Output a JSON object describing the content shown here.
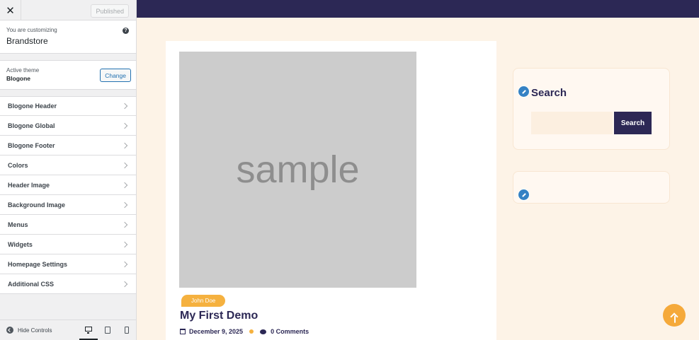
{
  "sidebar": {
    "close_icon": "close-icon",
    "publish_label": "Published",
    "customizing_label": "You are customizing",
    "site_name": "Brandstore",
    "active_theme_label": "Active theme",
    "theme_name": "Blogone",
    "change_label": "Change",
    "sections": [
      {
        "label": "Blogone Header"
      },
      {
        "label": "Blogone Global"
      },
      {
        "label": "Blogone Footer"
      },
      {
        "label": "Colors"
      },
      {
        "label": "Header Image"
      },
      {
        "label": "Background Image"
      },
      {
        "label": "Menus"
      },
      {
        "label": "Widgets"
      },
      {
        "label": "Homepage Settings"
      },
      {
        "label": "Additional CSS"
      }
    ],
    "hide_controls_label": "Hide Controls"
  },
  "preview": {
    "post": {
      "image_text": "sample",
      "author": "John Doe",
      "title": "My First Demo",
      "date": "December 9, 2025",
      "comments": "0 Comments"
    },
    "search_widget": {
      "title": "Search",
      "input_value": "",
      "button_label": "Search"
    }
  },
  "colors": {
    "header_bg": "#2c2855",
    "accent": "#f5b13f",
    "edit_shortcut": "#3582c4"
  }
}
